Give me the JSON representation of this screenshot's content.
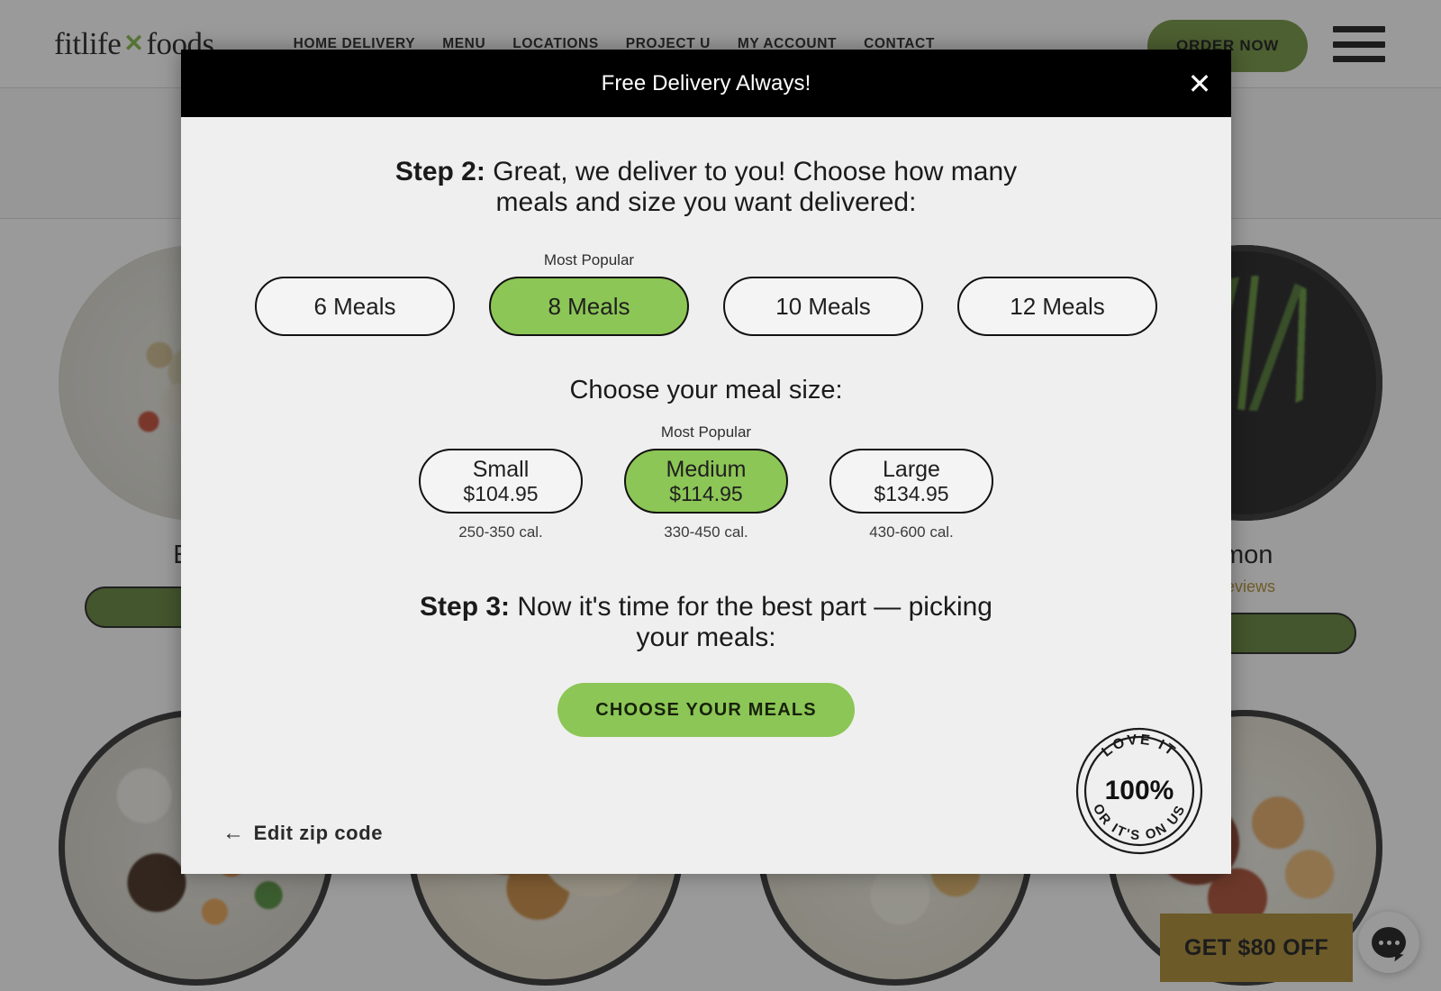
{
  "site": {
    "logo": {
      "left": "fitlife",
      "x": "✕",
      "right": "foods"
    },
    "nav": [
      {
        "label": "HOME DELIVERY"
      },
      {
        "label": "MENU"
      },
      {
        "label": "LOCATIONS"
      },
      {
        "label": "PROJECT U"
      },
      {
        "label": "MY ACCOUNT"
      },
      {
        "label": "CONTACT"
      }
    ],
    "order_now_label": "ORDER NOW",
    "promo_banner": "GET $80 OFF"
  },
  "products": [
    {
      "title": "Egg",
      "reviews": "",
      "button": ""
    },
    {
      "title": "",
      "reviews": "",
      "button": ""
    },
    {
      "title": "",
      "reviews": "",
      "button": ""
    },
    {
      "title": "lmon",
      "reviews": "Reviews",
      "button": ""
    }
  ],
  "modal": {
    "banner_title": "Free Delivery Always!",
    "close_icon": "✕",
    "step2": {
      "label": "Step 2:",
      "text": " Great, we deliver to you! Choose how many meals and size you want delivered:"
    },
    "meal_counts": [
      {
        "label": "6 Meals",
        "tag": "",
        "selected": false
      },
      {
        "label": "8 Meals",
        "tag": "Most Popular",
        "selected": true
      },
      {
        "label": "10 Meals",
        "tag": "",
        "selected": false
      },
      {
        "label": "12 Meals",
        "tag": "",
        "selected": false
      }
    ],
    "size_heading": "Choose your meal size:",
    "meal_sizes": [
      {
        "name": "Small",
        "price": "$104.95",
        "calories": "250-350 cal.",
        "tag": "",
        "selected": false
      },
      {
        "name": "Medium",
        "price": "$114.95",
        "calories": "330-450 cal.",
        "tag": "Most Popular",
        "selected": true
      },
      {
        "name": "Large",
        "price": "$134.95",
        "calories": "430-600 cal.",
        "tag": "",
        "selected": false
      }
    ],
    "step3": {
      "label": "Step 3:",
      "text": " Now it's time for the best part — picking your meals:"
    },
    "cta_label": "CHOOSE YOUR MEALS",
    "edit_zip": {
      "arrow": "←",
      "label": "Edit zip code"
    },
    "guarantee": {
      "top_arc": "LOVE IT",
      "center": "100%",
      "bottom_arc": "OR IT'S ON US"
    }
  },
  "colors": {
    "accent_green": "#8cc656",
    "brand_green": "#6f9239",
    "promo_gold": "#a8872a",
    "modal_bg": "#efefef",
    "banner_bg": "#000000"
  }
}
